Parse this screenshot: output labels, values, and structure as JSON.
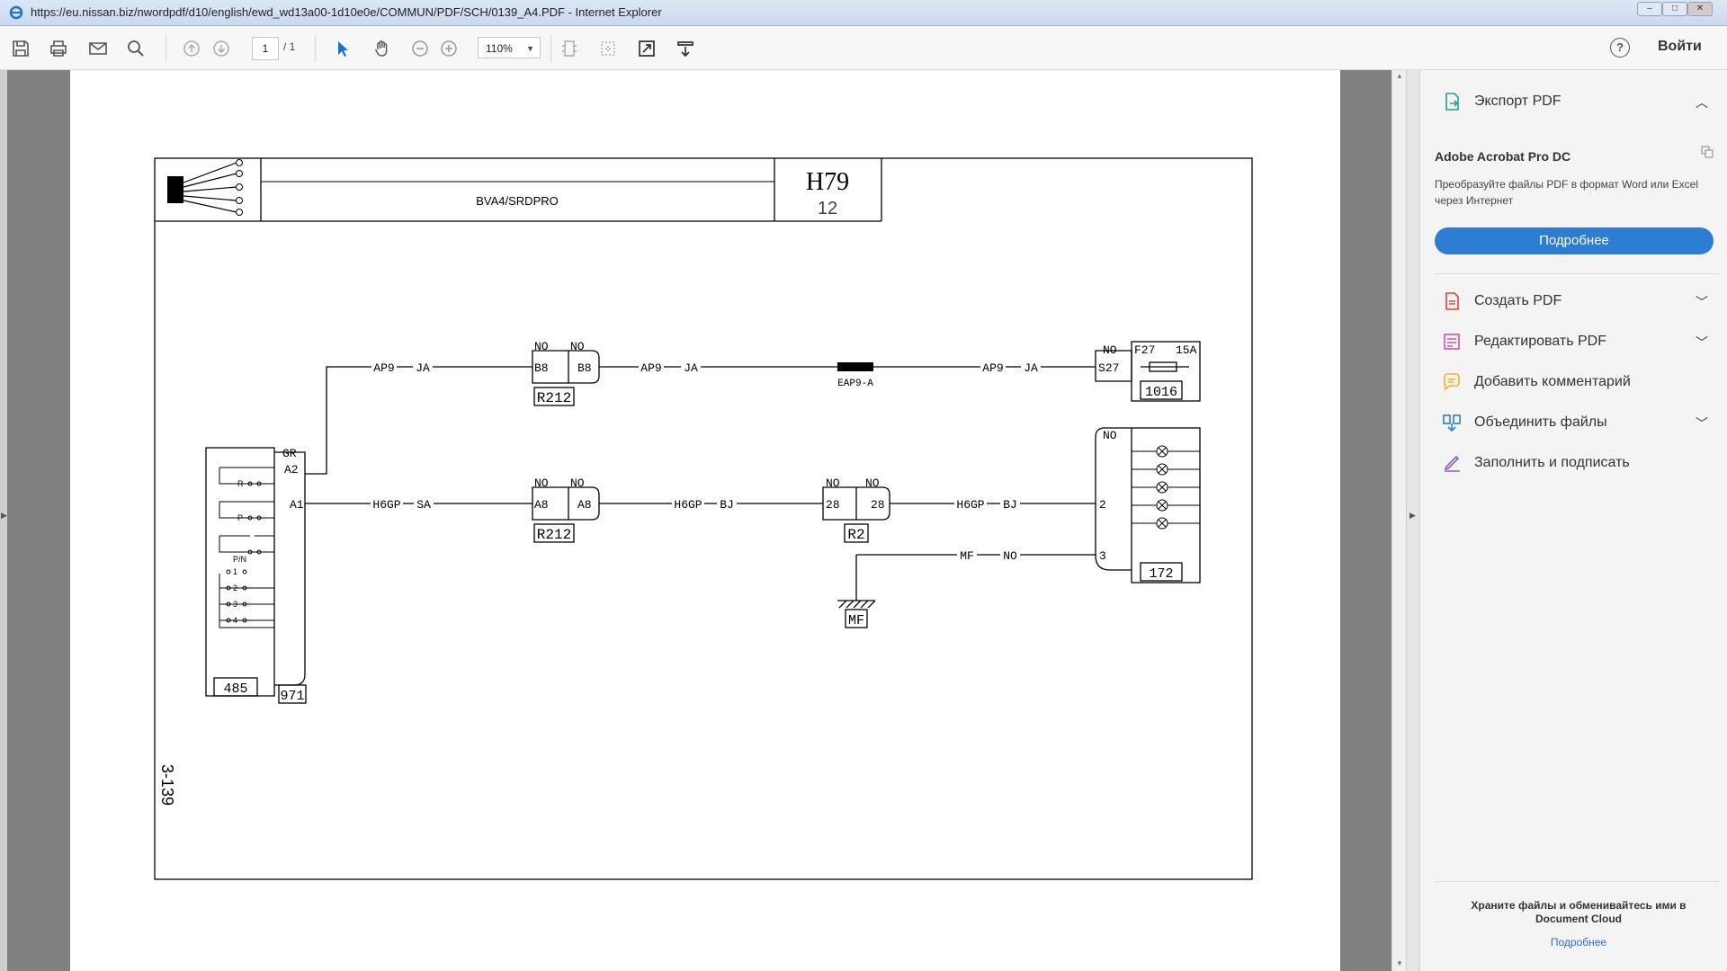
{
  "window": {
    "title": "https://eu.nissan.biz/nwordpdf/d10/english/ewd_wd13a00-1d10e0e/COMMUN/PDF/SCH/0139_A4.PDF - Internet Explorer"
  },
  "toolbar": {
    "page_current": "1",
    "page_total": "/ 1",
    "zoom": "110%",
    "help": "?",
    "sign_in": "Войти"
  },
  "right_panel": {
    "export_pdf": "Экспорт PDF",
    "acrobat_title": "Adobe Acrobat Pro DC",
    "acrobat_desc": "Преобразуйте файлы PDF в формат Word или Excel через Интернет",
    "learn_more_button": "Подробнее",
    "tools": [
      {
        "label": "Создать PDF",
        "icon": "create-pdf-icon",
        "color": "#e0413a"
      },
      {
        "label": "Редактировать PDF",
        "icon": "edit-pdf-icon",
        "color": "#d94fa3"
      },
      {
        "label": "Добавить комментарий",
        "icon": "comment-icon",
        "color": "#f5b11e"
      },
      {
        "label": "Объединить файлы",
        "icon": "combine-files-icon",
        "color": "#2d7dd2"
      },
      {
        "label": "Заполнить и подписать",
        "icon": "fill-sign-icon",
        "color": "#8a5bd6"
      }
    ],
    "cloud_text": "Храните файлы и обменивайтесь ими в Document Cloud",
    "cloud_link": "Подробнее"
  },
  "schematic": {
    "header_title": "BVA4/SRDPRO",
    "sheet_code": "H79",
    "sheet_number": "12",
    "page_ref": "3-139",
    "wire_labels": {
      "ap9": "AP9",
      "ja": "JA",
      "h6gp": "H6GP",
      "sa": "SA",
      "bj": "BJ",
      "mf": "MF",
      "no": "NO",
      "gr": "GR"
    },
    "splice": "EAP9-A",
    "connectors": {
      "r212": "R212",
      "r2": "R2",
      "mf_ground": "MF",
      "c485": "485",
      "c971": "971",
      "c1016": "1016",
      "c172": "172"
    },
    "pins": {
      "b8": "B8",
      "a8": "A8",
      "a1": "A1",
      "a2": "A2",
      "p28": "28",
      "s27": "S27",
      "p2": "2",
      "p3": "3"
    },
    "fuse": {
      "label": "F27",
      "rating": "15A"
    },
    "switch_positions": [
      "R",
      "P",
      "P/N",
      "1",
      "2",
      "3",
      "4"
    ]
  }
}
